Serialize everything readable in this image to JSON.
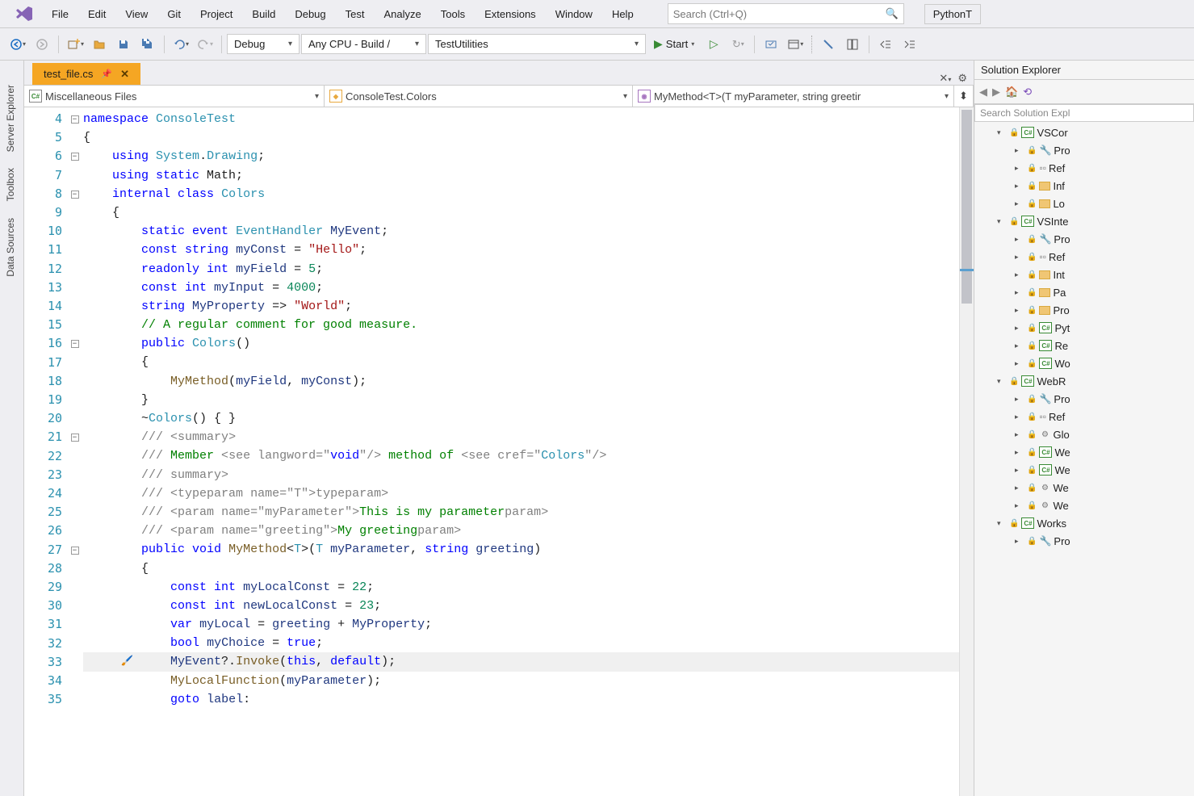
{
  "menu": {
    "file": "File",
    "edit": "Edit",
    "view": "View",
    "git": "Git",
    "project": "Project",
    "build": "Build",
    "debug": "Debug",
    "test": "Test",
    "analyze": "Analyze",
    "tools": "Tools",
    "extensions": "Extensions",
    "window": "Window",
    "help": "Help",
    "search_placeholder": "Search (Ctrl+Q)",
    "python_tab": "PythonT"
  },
  "toolbar": {
    "config": "Debug",
    "platform": "Any CPU - Build /",
    "startup": "TestUtilities",
    "start_label": "Start"
  },
  "left_tabs": {
    "server_explorer": "Server Explorer",
    "toolbox": "Toolbox",
    "data_sources": "Data Sources"
  },
  "editor": {
    "active_tab": "test_file.cs",
    "nav_project": "Miscellaneous Files",
    "nav_class": "ConsoleTest.Colors",
    "nav_member": "MyMethod<T>(T myParameter, string greetir",
    "line_start": 4,
    "lines": [
      4,
      5,
      6,
      7,
      8,
      9,
      10,
      11,
      12,
      13,
      14,
      15,
      16,
      17,
      18,
      19,
      20,
      21,
      22,
      23,
      24,
      25,
      26,
      27,
      28,
      29,
      30,
      31,
      32,
      33,
      34,
      35
    ]
  },
  "code": {
    "l4": {
      "kw": "namespace",
      "type": "ConsoleTest"
    },
    "l5": "{",
    "l6": {
      "kw": "using",
      "ns": "System",
      "dot": ".",
      "cls": "Drawing",
      "end": ";"
    },
    "l7": {
      "kw": "using static",
      "cls": "Math",
      "end": ";"
    },
    "l8": {
      "kw": "internal class",
      "cls": "Colors"
    },
    "l9": "{",
    "l10": {
      "kw": "static event",
      "type": "EventHandler",
      "name": "MyEvent",
      "end": ";"
    },
    "l11": {
      "kw": "const string",
      "name": "myConst",
      "eq": " = ",
      "val": "\"Hello\"",
      "end": ";"
    },
    "l12": {
      "kw": "readonly int",
      "name": "myField",
      "eq": " = ",
      "val": "5",
      "end": ";"
    },
    "l13": {
      "kw": "const int",
      "name": "myInput",
      "eq": " = ",
      "val": "4000",
      "end": ";"
    },
    "l14": {
      "kw": "string",
      "name": "MyProperty",
      "arrow": " => ",
      "val": "\"World\"",
      "end": ";"
    },
    "l15": "// A regular comment for good measure.",
    "l16": {
      "kw": "public",
      "cls": "Colors",
      "parens": "()"
    },
    "l17": "{",
    "l18": {
      "fn": "MyMethod",
      "args_open": "(",
      "a1": "myField",
      "comma": ", ",
      "a2": "myConst",
      "args_close": ");"
    },
    "l19": "}",
    "l20": {
      "tilde": "~",
      "cls": "Colors",
      "rest": "() { }"
    },
    "l21": {
      "pre": "/// ",
      "open": "<",
      "tag": "summary",
      "close": ">"
    },
    "l22": {
      "pre": "/// ",
      "t1": "Member ",
      "open1": "<",
      "tag1": "see",
      "attr1": " langword",
      "eq1": "=",
      "val1": "\"void\"",
      "close1": "/>",
      "t2": " method of ",
      "open2": "<",
      "tag2": "see",
      "attr2": " cref",
      "eq2": "=",
      "val2": "\"Colors\"",
      "close2": "/>"
    },
    "l23": {
      "pre": "/// ",
      "open": "</",
      "tag": "summary",
      "close": ">"
    },
    "l24": {
      "pre": "/// ",
      "open": "<",
      "tag": "typeparam",
      "attr": " name",
      "eq": "=",
      "val": "\"T\"",
      "mid": "></",
      "tag2": "typeparam",
      "close": ">"
    },
    "l25": {
      "pre": "/// ",
      "open": "<",
      "tag": "param",
      "attr": " name",
      "eq": "=",
      "val": "\"myParameter\"",
      "mid": ">",
      "txt": "This is my parameter",
      "end": "</",
      "tag2": "param",
      "close": ">"
    },
    "l26": {
      "pre": "/// ",
      "open": "<",
      "tag": "param",
      "attr": " name",
      "eq": "=",
      "val": "\"greeting\"",
      "mid": ">",
      "txt": "My greeting",
      "end": "</",
      "tag2": "param",
      "close": ">"
    },
    "l27": {
      "kw": "public void",
      "fn": "MyMethod",
      "open": "<",
      "t": "T",
      "close": ">(",
      "t2": "T",
      "p1": " myParameter",
      ",": ", ",
      "str": "string",
      "p2": " greeting",
      "end": ")"
    },
    "l28": "{",
    "l29": {
      "kw": "const int",
      "name": "myLocalConst",
      "eq": " = ",
      "val": "22",
      "end": ";"
    },
    "l30": {
      "kw": "const int",
      "name": "newLocalConst",
      "eq": " = ",
      "val": "23",
      "end": ";"
    },
    "l31": {
      "kw": "var",
      "name": "myLocal",
      "eq": " = ",
      "a": "greeting",
      "plus": " + ",
      "b": "MyProperty",
      "end": ";"
    },
    "l32": {
      "kw": "bool",
      "name": "myChoice",
      "eq": " = ",
      "val": "true",
      "end": ";"
    },
    "l33": {
      "evt": "MyEvent",
      "q": "?",
      "dot": ".",
      "fn": "Invoke",
      "open": "(",
      "this": "this",
      "comma": ", ",
      "def": "default",
      "end": ");"
    },
    "l34": {
      "fn": "MyLocalFunction",
      "open": "(",
      "arg": "myParameter",
      "end": ");"
    },
    "l35": {
      "kw": "goto",
      "lbl": "label",
      "end": ":"
    }
  },
  "solution": {
    "title": "Solution Explorer",
    "search_placeholder": "Search Solution Expl",
    "projects": [
      {
        "name": "VSCor",
        "items": [
          {
            "name": "Pro",
            "icon": "wrench"
          },
          {
            "name": "Ref",
            "icon": "ref"
          },
          {
            "name": "Inf",
            "icon": "folder"
          },
          {
            "name": "Lo",
            "icon": "folder"
          }
        ]
      },
      {
        "name": "VSInte",
        "items": [
          {
            "name": "Pro",
            "icon": "wrench"
          },
          {
            "name": "Ref",
            "icon": "ref"
          },
          {
            "name": "Int",
            "icon": "folder"
          },
          {
            "name": "Pa",
            "icon": "folder"
          },
          {
            "name": "Pro",
            "icon": "folder"
          },
          {
            "name": "Pyt",
            "icon": "cs"
          },
          {
            "name": "Re",
            "icon": "cs"
          },
          {
            "name": "Wo",
            "icon": "cs"
          }
        ]
      },
      {
        "name": "WebR",
        "items": [
          {
            "name": "Pro",
            "icon": "wrench"
          },
          {
            "name": "Ref",
            "icon": "ref"
          },
          {
            "name": "Glo",
            "icon": "cfg"
          },
          {
            "name": "We",
            "icon": "cs"
          },
          {
            "name": "We",
            "icon": "cs"
          },
          {
            "name": "We",
            "icon": "cfg"
          },
          {
            "name": "We",
            "icon": "cfg"
          }
        ]
      },
      {
        "name": "Works",
        "items": [
          {
            "name": "Pro",
            "icon": "wrench"
          }
        ]
      }
    ]
  }
}
